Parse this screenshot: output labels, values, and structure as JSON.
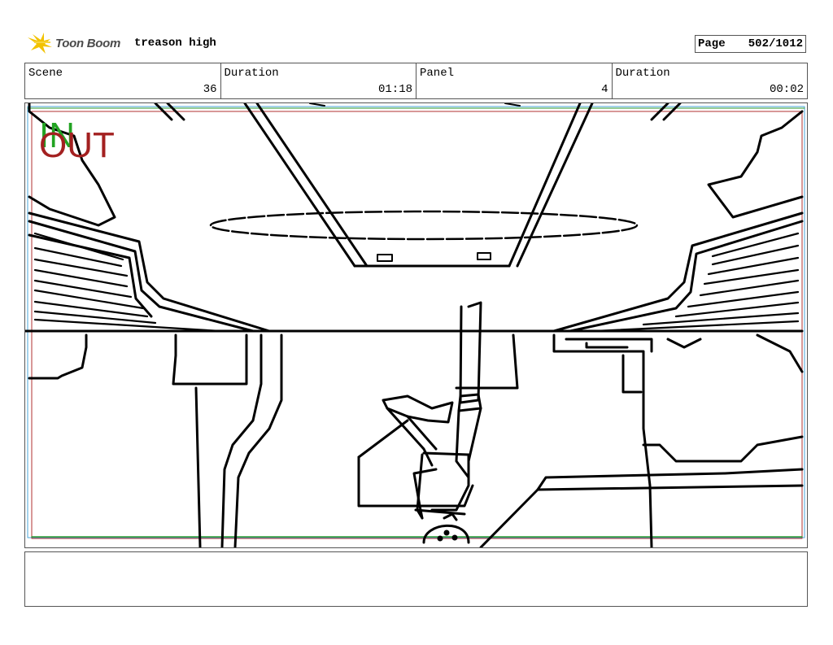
{
  "header": {
    "logo_text": "Toon Boom",
    "project_name": "treason high",
    "page_label": "Page",
    "page_value": "502/1012"
  },
  "info": {
    "scene_label": "Scene",
    "scene_value": "36",
    "duration1_label": "Duration",
    "duration1_value": "01:18",
    "panel_label": "Panel",
    "panel_value": "4",
    "duration2_label": "Duration",
    "duration2_value": "00:02"
  },
  "panel": {
    "in_mark": "IN",
    "out_mark": "OUT",
    "in_color": "#22a322",
    "out_color": "#a32020"
  },
  "notes": {
    "text": ""
  },
  "colors": {
    "logo_star": "#f2c200",
    "frame_border": "#555555"
  }
}
